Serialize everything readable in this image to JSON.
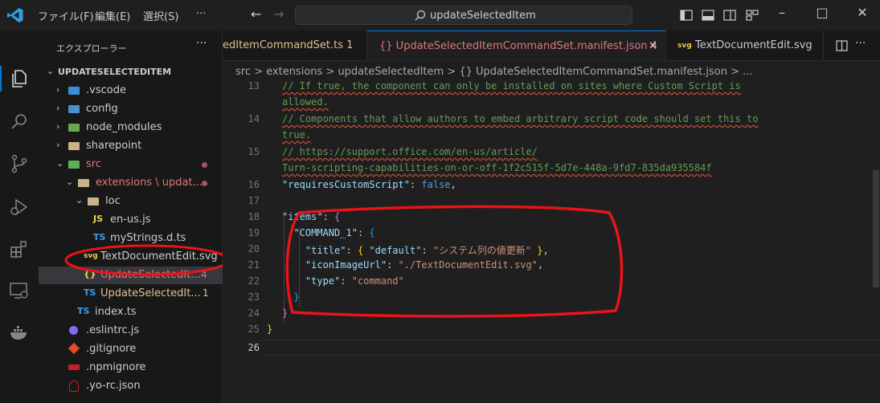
{
  "titlebar": {
    "menus": [
      "ファイル(F)",
      "編集(E)",
      "選択(S)",
      "···"
    ],
    "search": "updateSelectedItem"
  },
  "sidebar": {
    "title": "エクスプローラー",
    "more": "···",
    "root": "UPDATESELECTEDITEM",
    "items": [
      {
        "label": ".vscode"
      },
      {
        "label": "config"
      },
      {
        "label": "node_modules"
      },
      {
        "label": "sharepoint"
      },
      {
        "label": "src"
      },
      {
        "label": "extensions \\ updat..."
      },
      {
        "label": "loc"
      },
      {
        "label": "en-us.js",
        "type_label": "JS"
      },
      {
        "label": "myStrings.d.ts",
        "type_label": "TS"
      },
      {
        "label": "TextDocumentEdit.svg",
        "type_label": "svg"
      },
      {
        "label": "UpdateSelectedIt...",
        "type_label": "{}",
        "badge": "4"
      },
      {
        "label": "UpdateSelectedIt...",
        "type_label": "TS",
        "badge": "1"
      },
      {
        "label": "index.ts",
        "type_label": "TS"
      },
      {
        "label": ".eslintrc.js"
      },
      {
        "label": ".gitignore"
      },
      {
        "label": ".npmignore"
      },
      {
        "label": ".yo-rc.json"
      }
    ]
  },
  "tabs": [
    {
      "label": "edItemCommandSet.ts 1"
    },
    {
      "label": "{} UpdateSelectedItemCommandSet.manifest.json 4",
      "close": "✕"
    },
    {
      "label": "TextDocumentEdit.svg",
      "icon_label": "svg"
    }
  ],
  "breadcrumb": "src > extensions > updateSelectedItem > {} UpdateSelectedItemCommandSet.manifest.json > ...",
  "editor": {
    "line_numbers": [
      "13",
      "",
      "14",
      "",
      "15",
      "",
      "16",
      "17",
      "18",
      "19",
      "20",
      "21",
      "22",
      "23",
      "24",
      "25",
      "26"
    ],
    "comment_lines": [
      "// If true, the component can only be installed on sites where Custom Script is",
      "allowed.",
      "// Components that allow authors to embed arbitrary script code should set this to",
      "true.",
      "// https://support.office.com/en-us/article/",
      "Turn-scripting-capabilities-on-or-off-1f2c515f-5d7e-448a-9fd7-835da935584f"
    ],
    "line16_key": "\"requiresCustomScript\"",
    "line16_value": "false",
    "line18_key": "\"items\"",
    "line19_key": "\"COMMAND_1\"",
    "line20_key": "\"title\"",
    "line20_inner_key": "\"default\"",
    "line20_value": "\"システム列の値更新\"",
    "line21_key": "\"iconImageUrl\"",
    "line21_value": "\"./TextDocumentEdit.svg\"",
    "line22_key": "\"type\"",
    "line22_value": "\"command\""
  },
  "colors": {
    "accent": "#0078d4",
    "annotation": "#e8141a"
  }
}
